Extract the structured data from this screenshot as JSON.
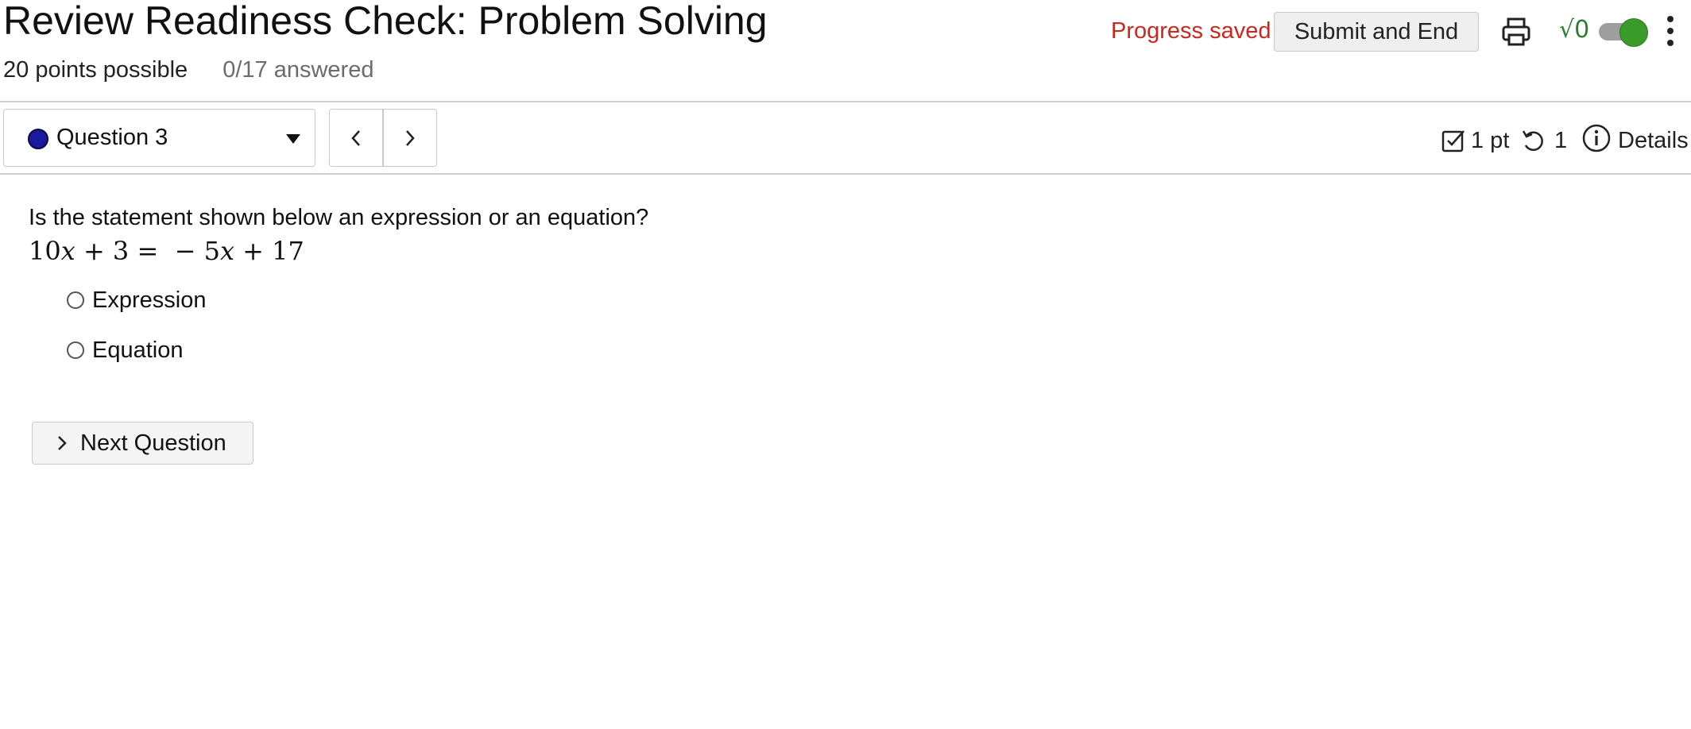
{
  "header": {
    "title": "Review Readiness Check: Problem Solving",
    "points_possible": "20 points possible",
    "answered": "0/17 answered",
    "progress_status": "Progress saved",
    "submit_label": "Submit and End",
    "math_toggle_label": "√0",
    "math_toggle_on": true
  },
  "question_nav": {
    "selected_question": "Question 3",
    "status_color": "#1a1aa0",
    "points": "1 pt",
    "attempts": "1",
    "details_label": "Details"
  },
  "question": {
    "prompt": "Is the statement shown below an expression or an equation?",
    "math": {
      "lhs_coef": "10",
      "lhs_var": "x",
      "lhs_rest": " + 3 = ",
      "rhs_sign": " − 5",
      "rhs_var": "x",
      "rhs_rest": " + 17"
    },
    "options": [
      {
        "label": "Expression",
        "selected": false
      },
      {
        "label": "Equation",
        "selected": false
      }
    ],
    "next_label": "Next Question"
  },
  "icons": {
    "print": "print-icon",
    "more": "more-vertical-icon",
    "caret": "caret-down-icon",
    "prev": "chevron-left-icon",
    "next": "chevron-right-icon",
    "points": "checkbox-icon",
    "retry": "retry-icon",
    "info": "info-icon"
  },
  "colors": {
    "progress_saved": "#c8281e",
    "toggle_on": "#3a9a2a",
    "sqrt_label": "#2e7d32"
  }
}
